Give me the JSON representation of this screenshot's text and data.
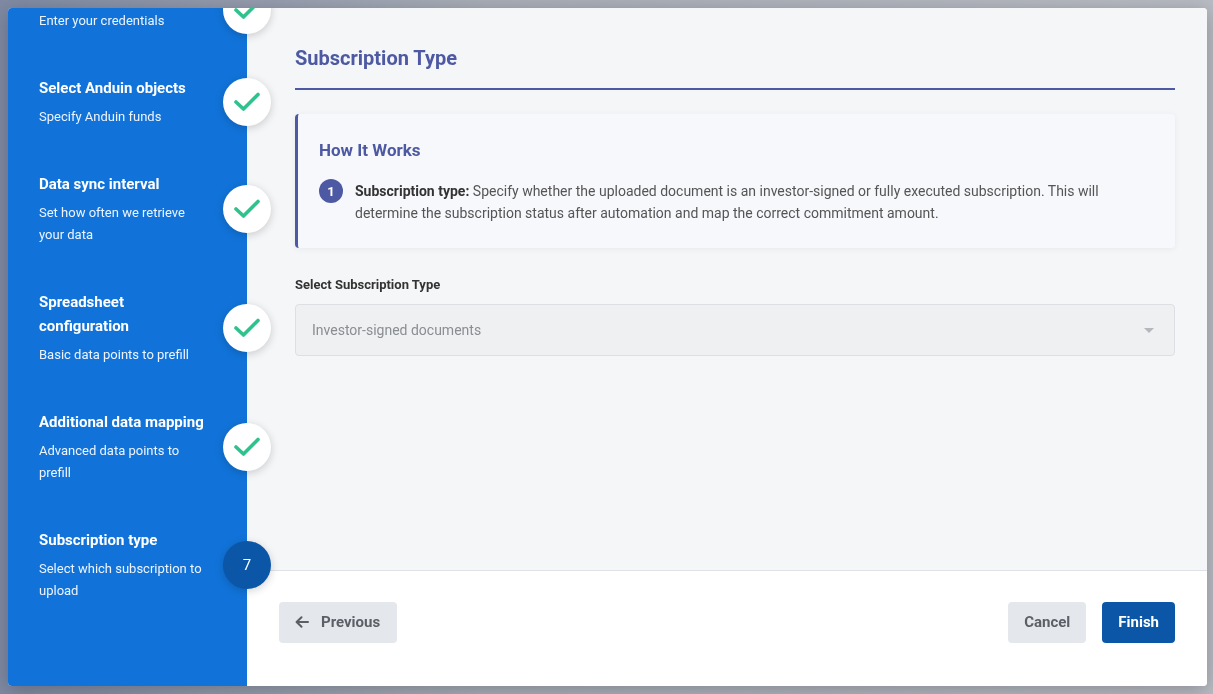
{
  "steps": [
    {
      "description": "Enter your credentials",
      "kind": "done"
    },
    {
      "title": "Select Anduin objects",
      "description": "Specify Anduin funds",
      "kind": "done"
    },
    {
      "title": "Data sync interval",
      "description": "Set how often we retrieve your data",
      "kind": "done"
    },
    {
      "title": "Spreadsheet configuration",
      "description": "Basic data points to prefill",
      "kind": "done"
    },
    {
      "title": "Additional data mapping",
      "description": "Advanced data points to prefill",
      "kind": "done"
    },
    {
      "title": "Subscription type",
      "description": "Select which subscription to upload",
      "kind": "current",
      "number": "7"
    }
  ],
  "section_title": "Subscription Type",
  "info_box": {
    "heading": "How It Works",
    "items": [
      {
        "number": "1",
        "text": "**Subscription type:** Specify whether the uploaded document is an investor-signed or fully executed subscription. This will determine the subscription status after automation and map the correct commitment amount."
      }
    ]
  },
  "field": {
    "label": "Select Subscription Type",
    "value": "Investor-signed documents",
    "disabled": true
  },
  "footer": {
    "previous": "Previous",
    "cancel": "Cancel",
    "finish": "Finish"
  }
}
